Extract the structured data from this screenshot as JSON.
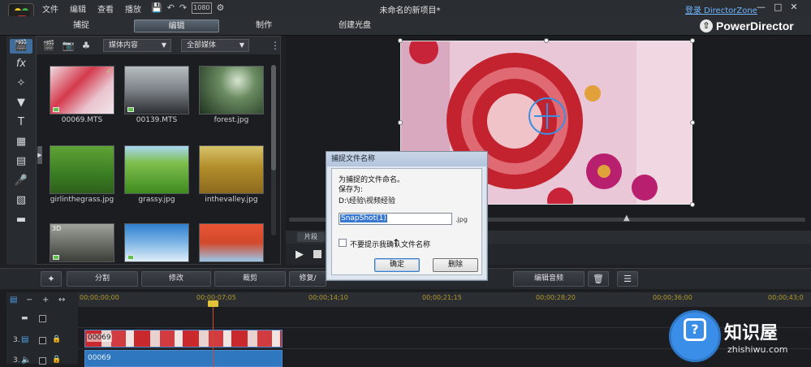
{
  "menu": [
    "文件",
    "编辑",
    "查看",
    "播放"
  ],
  "toolbar_icons": [
    "save-icon",
    "undo-icon",
    "redo-icon",
    "resolution-icon",
    "settings-icon"
  ],
  "toolbar_resolution": "1080",
  "document_title": "未命名的新项目*",
  "login_link": "登录 DirectorZone",
  "window_buttons": [
    "minimize-icon",
    "maximize-icon",
    "close-icon"
  ],
  "modes": {
    "capture": "捕捉",
    "edit": "编辑",
    "produce": "制作",
    "create_disc": "创建光盘"
  },
  "brand": "PowerDirector",
  "left_tools": [
    "fx",
    "particle",
    "title",
    "transition",
    "subtitle",
    "voice",
    "chapter",
    "mask"
  ],
  "library": {
    "dropdown_content": "媒体内容",
    "dropdown_filter": "全部媒体",
    "items": [
      {
        "name": "00069.MTS",
        "badge3d": "",
        "checked": true,
        "video": true
      },
      {
        "name": "00139.MTS",
        "badge3d": "",
        "checked": false,
        "video": true
      },
      {
        "name": "forest.jpg",
        "badge3d": "",
        "checked": false,
        "video": false
      },
      {
        "name": "girlinthegrass.jpg",
        "badge3d": "",
        "checked": false,
        "video": false
      },
      {
        "name": "grassy.jpg",
        "badge3d": "",
        "checked": false,
        "video": false
      },
      {
        "name": "inthevalley.jpg",
        "badge3d": "",
        "checked": false,
        "video": false
      },
      {
        "name": "",
        "badge3d": "3D",
        "checked": false,
        "video": true
      },
      {
        "name": "",
        "badge3d": "",
        "checked": false,
        "video": true
      },
      {
        "name": "",
        "badge3d": "",
        "checked": false,
        "video": false
      }
    ]
  },
  "preview": {
    "tab_clip": "片段"
  },
  "dialog": {
    "title": "捕捉文件名称",
    "line1": "为捕捉的文件命名。",
    "line2": "保存为:",
    "path": "D:\\经验\\视频经验",
    "filename": "SnapShot(1)",
    "ext": ".jpg",
    "dont_ask": "不要提示我确认文件名称",
    "ok": "确定",
    "delete": "删除"
  },
  "edit_toolbar": {
    "split": "分割",
    "modify": "修改",
    "trim": "裁剪",
    "fix": "修复/",
    "edit_audio": "编辑音频"
  },
  "timeline": {
    "ruler": [
      "00;00;00;00",
      "00;00;07;05",
      "00;00;14;10",
      "00;00;21;15",
      "00;00;28;20",
      "00;00;36;00",
      "00;00;43;0"
    ],
    "track_video": "3.",
    "track_audio": "3.",
    "clip_video": "00069",
    "clip_audio": "00069"
  },
  "watermark": {
    "cn": "知识屋",
    "en": "zhishiwu.com"
  }
}
